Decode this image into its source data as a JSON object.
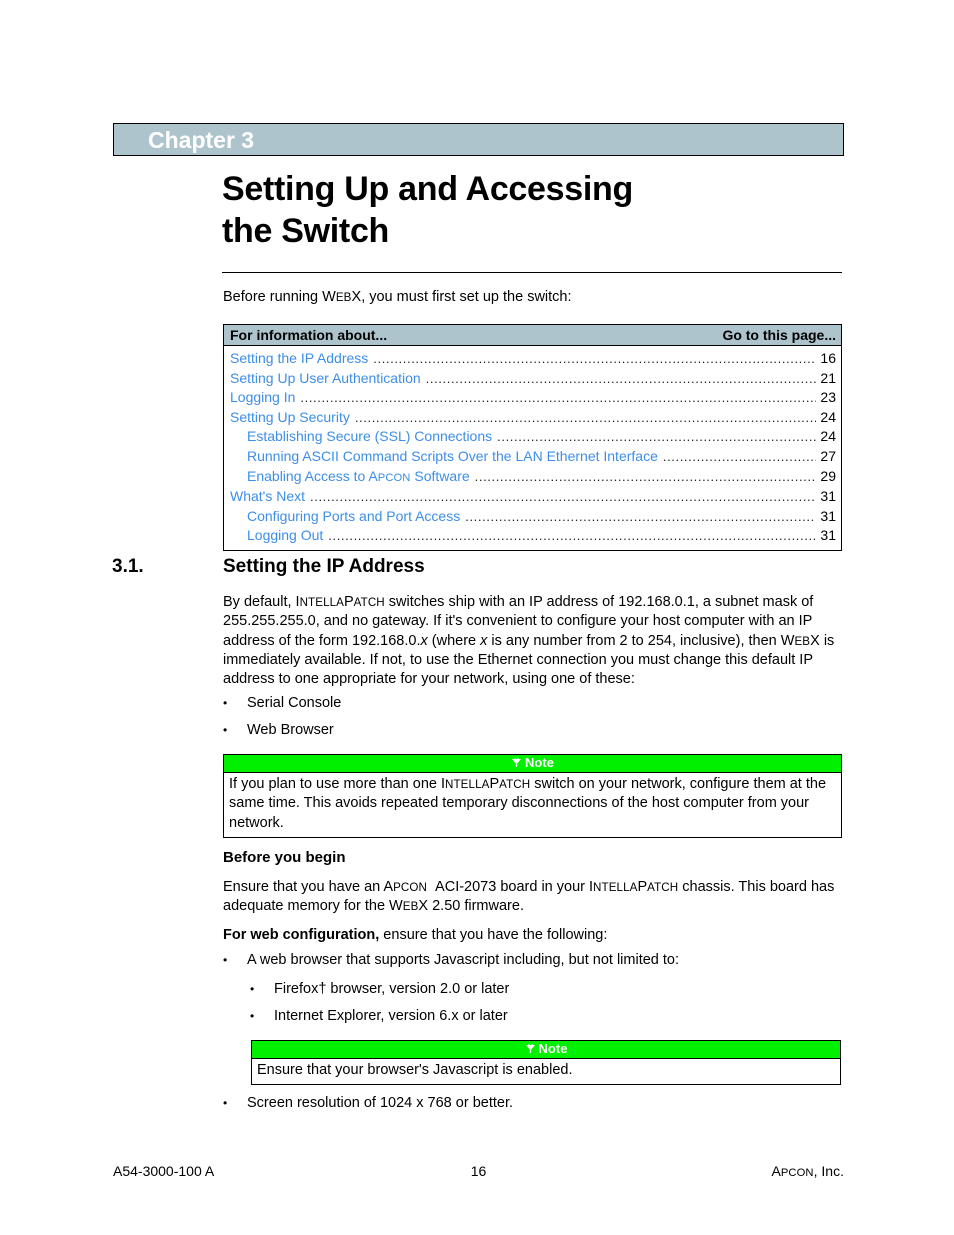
{
  "colors": {
    "banner_bg": "#aec4cd",
    "toc_header_bg": "#aec4cd",
    "link_blue": "#3d8ee8",
    "note_green": "#00f000",
    "text": "#000000"
  },
  "chapter": {
    "banner_label": "Chapter 3",
    "title_line1": "Setting Up and Accessing",
    "title_line2": "the Switch"
  },
  "intro": {
    "prefix": "Before running ",
    "product": "WebX",
    "suffix": ", you must first set up the switch:"
  },
  "toc": {
    "header_left": "For information about...",
    "header_right": "Go to this page...",
    "dots": "..........................................................................................................................................................",
    "rows": [
      {
        "label": "Setting the IP Address",
        "page": "16",
        "level": 1
      },
      {
        "label": "Setting Up User Authentication",
        "page": "21",
        "level": 1
      },
      {
        "label": "Logging In",
        "page": "23",
        "level": 1
      },
      {
        "label": "Setting Up Security",
        "page": "24",
        "level": 1
      },
      {
        "label": "Establishing Secure (SSL) Connections",
        "page": "24",
        "level": 2
      },
      {
        "label": "Running ASCII Command Scripts Over the LAN Ethernet Interface",
        "page": "27",
        "level": 2
      },
      {
        "label": "Enabling Access to Apcon Software",
        "page": "29",
        "level": 2
      },
      {
        "label": "What's Next",
        "page": "31",
        "level": 1
      },
      {
        "label": "Configuring Ports and Port Access",
        "page": "31",
        "level": 2
      },
      {
        "label": "Logging Out",
        "page": "31",
        "level": 2
      }
    ]
  },
  "section": {
    "number": "3.1.",
    "heading": "Setting the IP Address"
  },
  "paragraphs": {
    "ip_address": "By default, IntellaPatch switches ship with an IP address of 192.168.0.1, a subnet mask of 255.255.255.0, and no gateway. If it's convenient to configure your host computer with an IP address of the form 192.168.0.x (where x is any number from 2 to 254, inclusive), then WebX is immediately available. If not, to use the Ethernet connection you must change this default IP address to one appropriate for your network, using one of these:",
    "ensure_board": "Ensure that you have an Apcon  ACI-2073 board in your IntellaPatch chassis. This board has adequate memory for the WebX 2.50 firmware.",
    "web_config_bold": "For web configuration,",
    "web_config_rest": " ensure that you have the following:"
  },
  "bullets": {
    "marker": "•",
    "serial_console": "Serial Console",
    "web_browser": "Web Browser",
    "js_browser": "A web browser that supports Javascript including, but not limited to:",
    "firefox": "Firefox† browser, version 2.0 or later",
    "internet_explorer": "Internet Explorer, version 6.x or later",
    "screen_resolution": "Screen resolution of 1024 x 768 or better."
  },
  "subheading": {
    "before_you_begin": "Before you begin"
  },
  "notes": {
    "label": "Note",
    "icon": "note-hand-icon",
    "note1_text": "If you plan to use more than one IntellaPatch switch on your network, configure them at the same time. This avoids repeated temporary disconnections of the host computer from your network.",
    "note2_text": "Ensure that your browser's Javascript is enabled."
  },
  "footer": {
    "doc_number": "A54-3000-100 A",
    "page_number": "16",
    "company": "Apcon, Inc."
  }
}
